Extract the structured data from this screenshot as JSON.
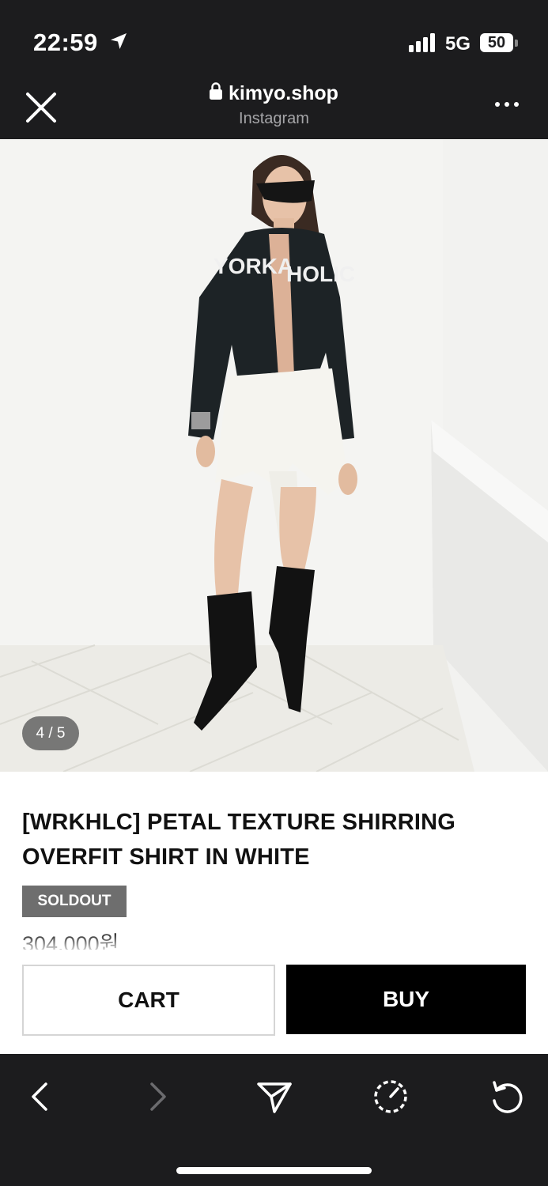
{
  "status_bar": {
    "time": "22:59",
    "network": "5G",
    "battery": "50"
  },
  "browser": {
    "domain": "kimyo.shop",
    "source": "Instagram"
  },
  "product": {
    "image_counter": "4 / 5",
    "title_line1": "[WRKHLC] PETAL TEXTURE SHIRRING",
    "title_line2": "OVERFIT SHIRT IN WHITE",
    "badge": "SOLDOUT",
    "price": "304.000원"
  },
  "actions": {
    "cart_label": "CART",
    "buy_label": "BUY"
  },
  "icons": {
    "location": "location-arrow-icon",
    "signal": "signal-bars-icon",
    "lock": "lock-icon",
    "close": "close-icon",
    "more": "more-dots-icon",
    "back": "chevron-left-icon",
    "forward": "chevron-right-icon",
    "share": "send-icon",
    "speed": "speedometer-icon",
    "reload": "reload-icon"
  },
  "colors": {
    "chrome_bg": "#1c1c1e",
    "buy_bg": "#000000",
    "badge_bg": "#6e6e6e"
  }
}
